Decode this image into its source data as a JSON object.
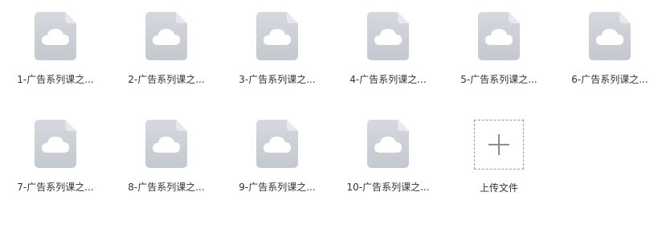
{
  "files": [
    {
      "name": "1-广告系列课之..."
    },
    {
      "name": "2-广告系列课之..."
    },
    {
      "name": "3-广告系列课之..."
    },
    {
      "name": "4-广告系列课之..."
    },
    {
      "name": "5-广告系列课之..."
    },
    {
      "name": "6-广告系列课之..."
    },
    {
      "name": "7-广告系列课之..."
    },
    {
      "name": "8-广告系列课之..."
    },
    {
      "name": "9-广告系列课之..."
    },
    {
      "name": "10-广告系列课之..."
    }
  ],
  "file_icon": "cloud-file-icon",
  "upload": {
    "label": "上传文件",
    "icon": "plus-icon"
  }
}
